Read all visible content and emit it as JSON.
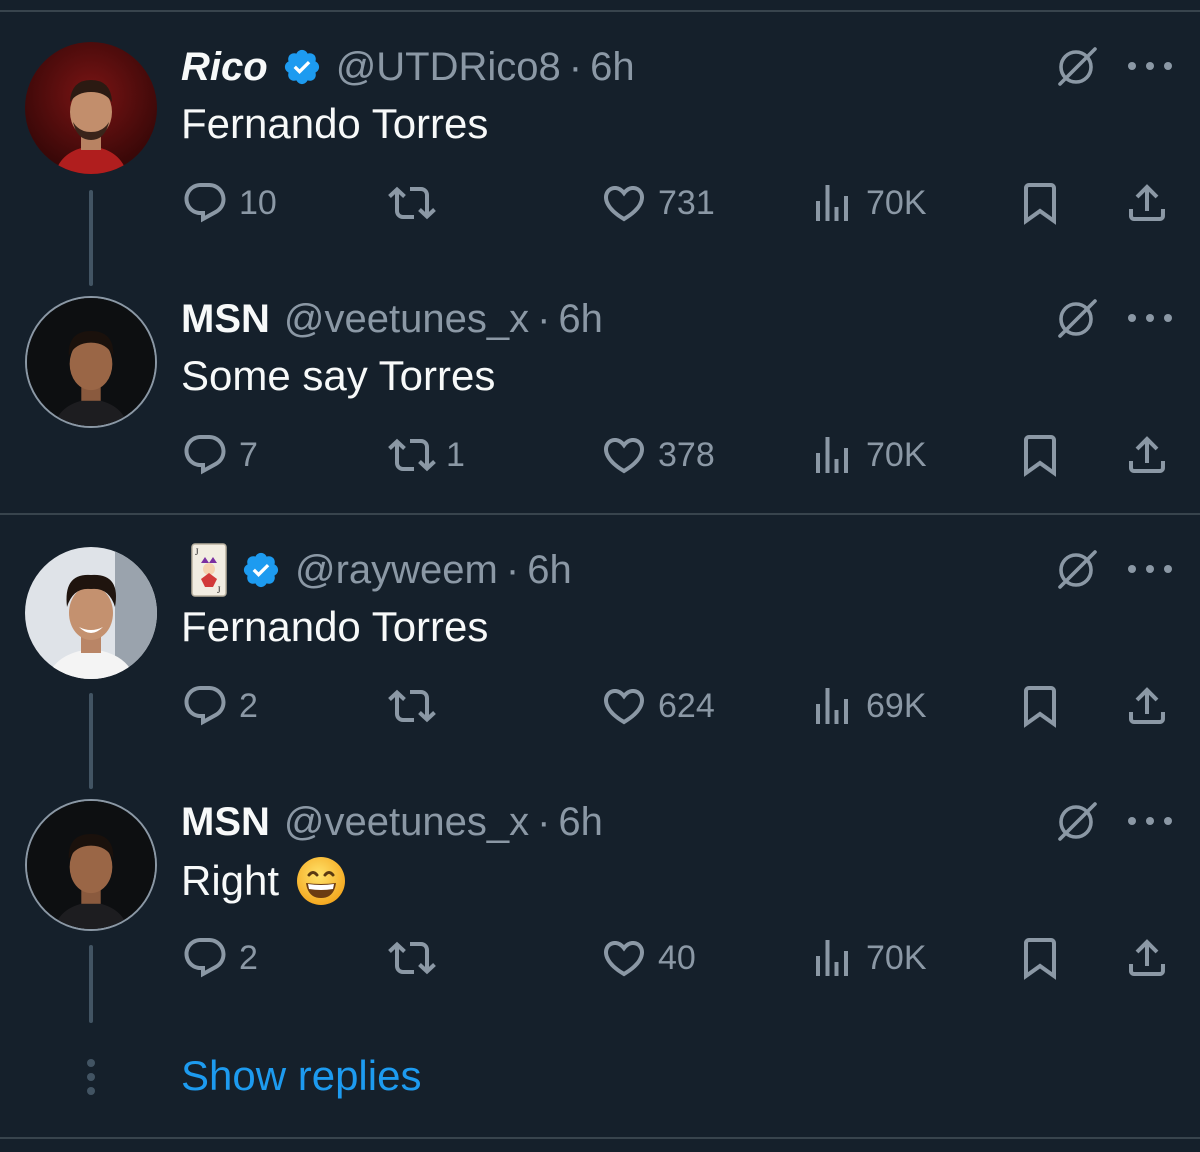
{
  "colors": {
    "background": "#15202b",
    "primary_text": "#f7f9f9",
    "secondary_text": "#8b98a5",
    "accent": "#1d9bf0",
    "divider": "#38444d"
  },
  "tweets": [
    {
      "name": "Rico",
      "verified": true,
      "handle": "@UTDRico8",
      "separator": "·",
      "time": "6h",
      "text": "Fernando Torres",
      "replies": "10",
      "retweets": "",
      "likes": "731",
      "views": "70K"
    },
    {
      "name": "MSN",
      "verified": false,
      "handle": "@veetunes_x",
      "separator": "·",
      "time": "6h",
      "text": "Some say Torres",
      "replies": "7",
      "retweets": "1",
      "likes": "378",
      "views": "70K"
    },
    {
      "name_emoji": "joker-card",
      "verified": true,
      "handle": "@rayweem",
      "separator": "·",
      "time": "6h",
      "text": "Fernando Torres",
      "replies": "2",
      "retweets": "",
      "likes": "624",
      "views": "69K"
    },
    {
      "name": "MSN",
      "verified": false,
      "handle": "@veetunes_x",
      "separator": "·",
      "time": "6h",
      "text": "Right",
      "text_emoji": "grinning-face",
      "replies": "2",
      "retweets": "",
      "likes": "40",
      "views": "70K"
    }
  ],
  "show_replies_label": "Show replies",
  "icons": {
    "reply": "reply-icon",
    "retweet": "retweet-icon",
    "like": "heart-icon",
    "views": "views-icon",
    "bookmark": "bookmark-icon",
    "share": "share-icon",
    "grok": "grok-icon",
    "more": "more-icon",
    "verified": "verified-badge-icon"
  }
}
